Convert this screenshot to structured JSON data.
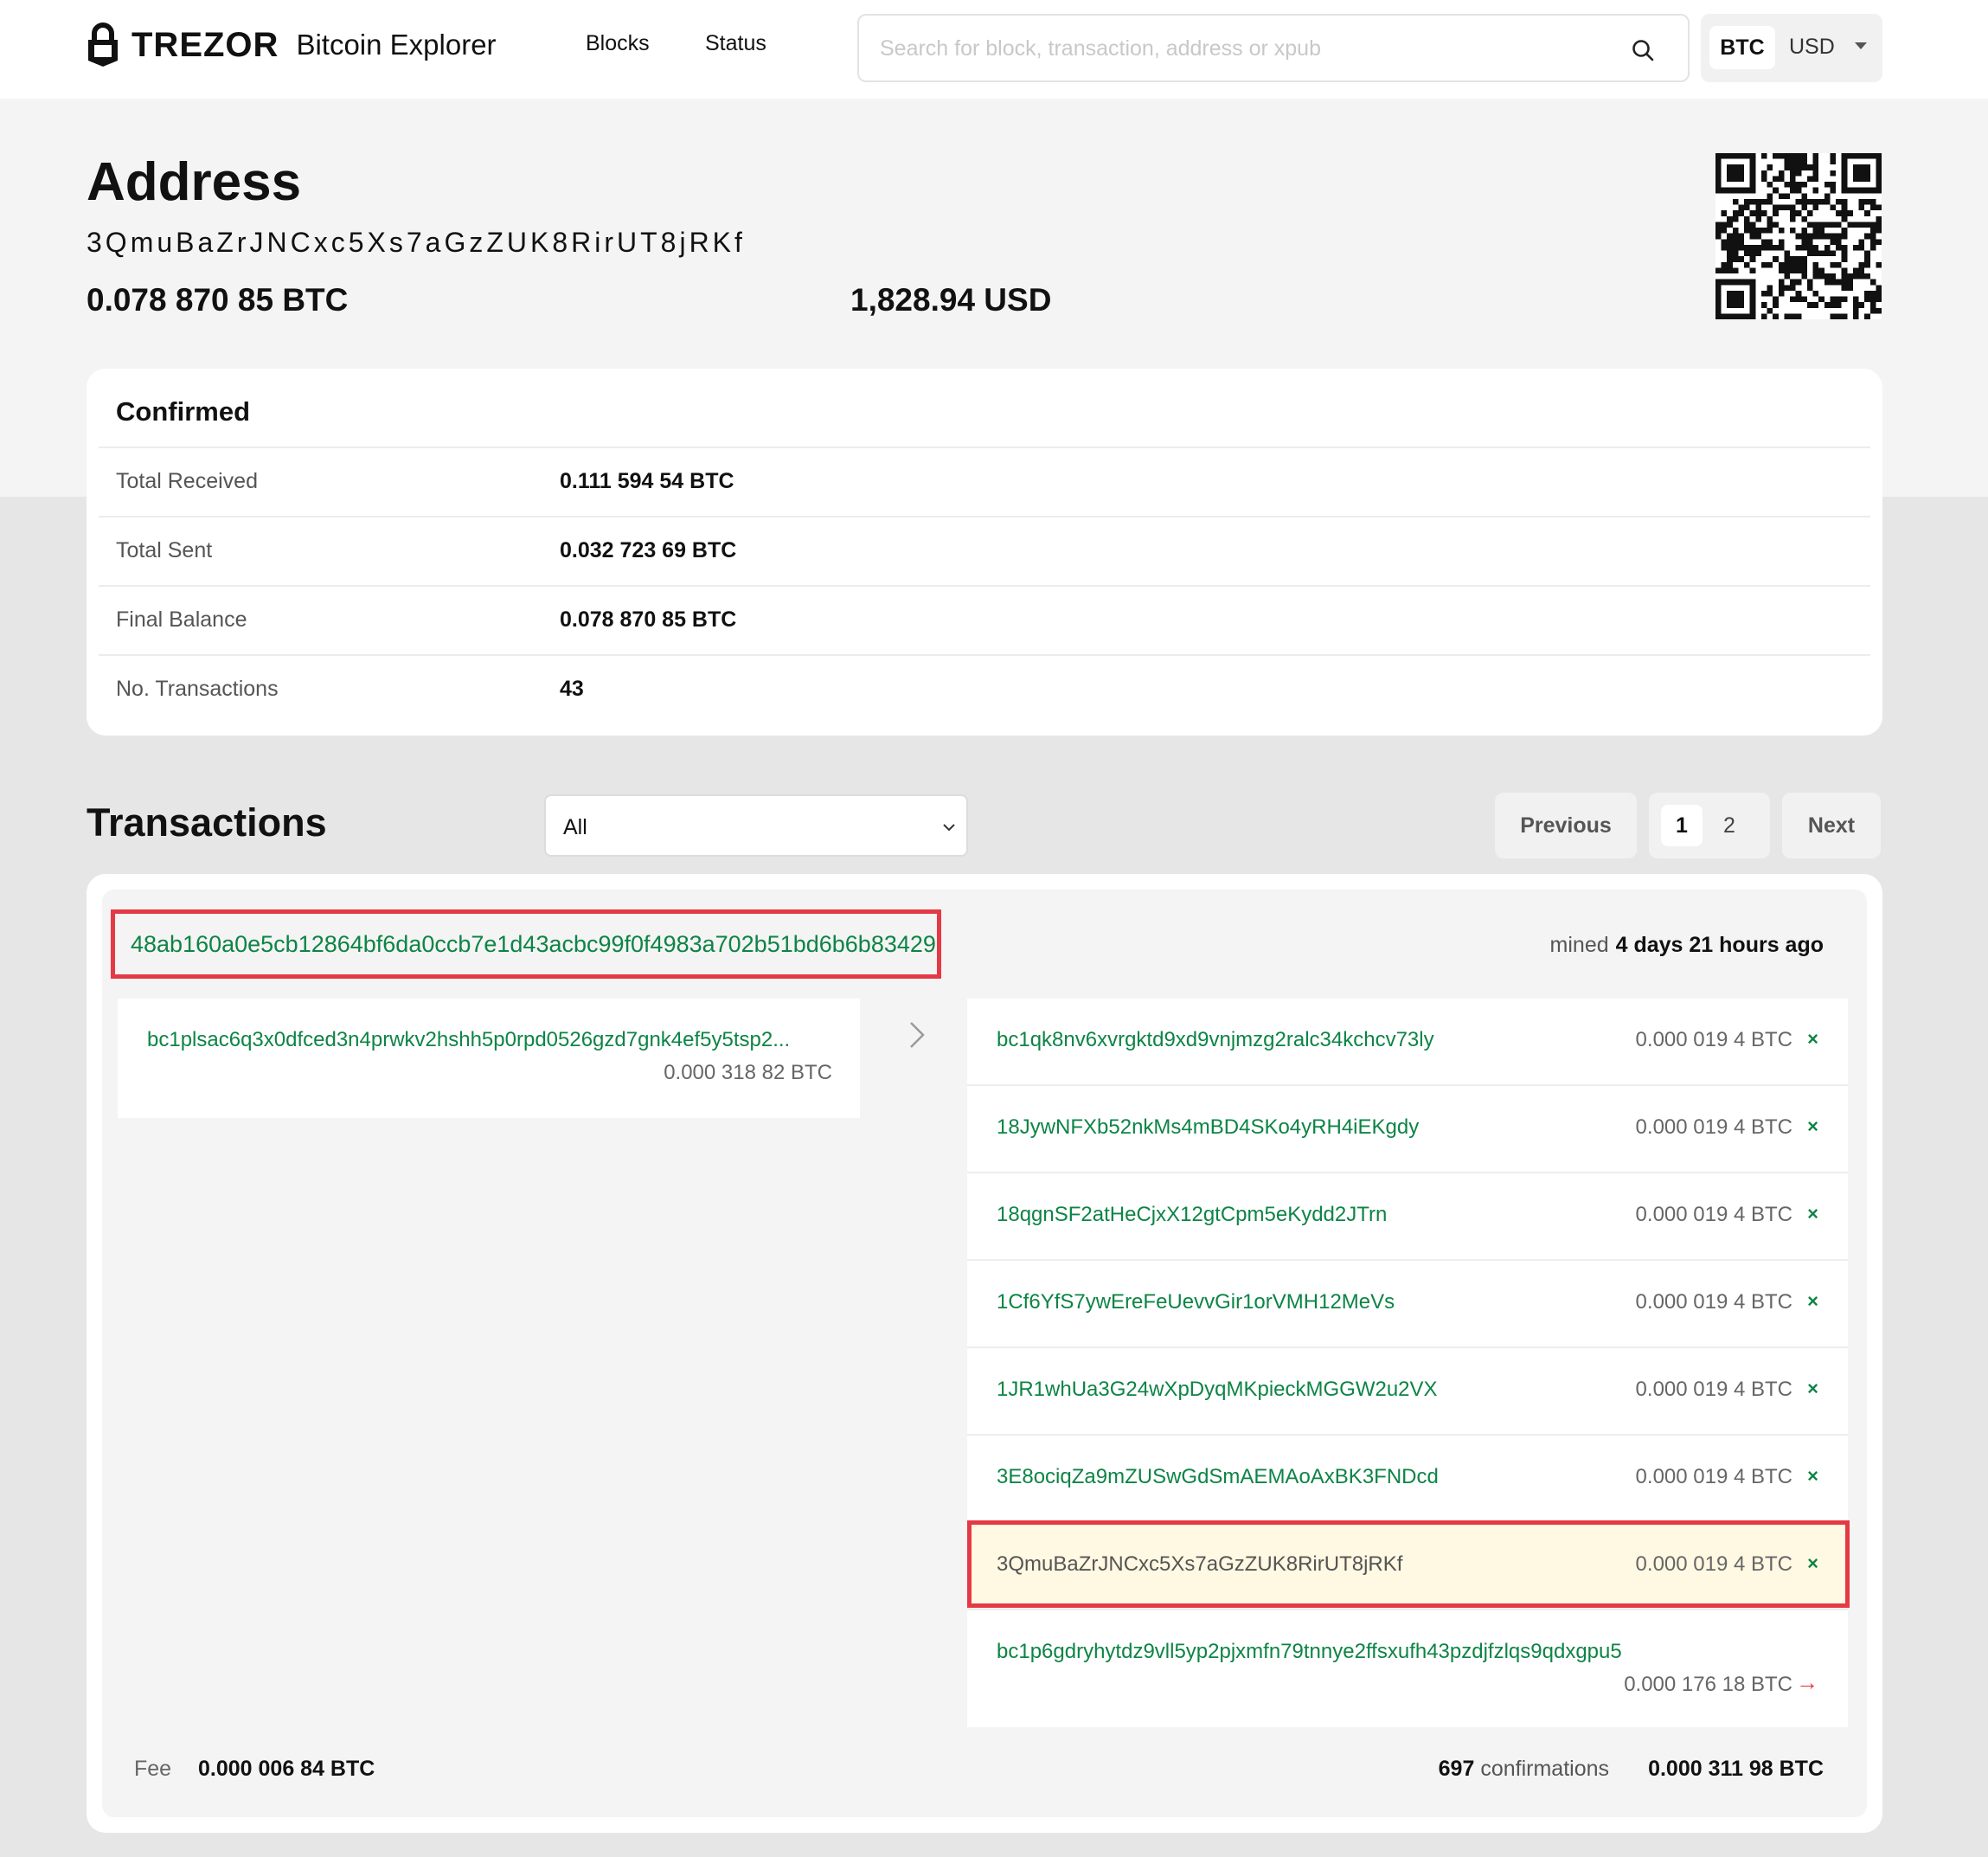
{
  "header": {
    "brand": "TREZOR",
    "app_name": "Bitcoin Explorer",
    "nav": [
      "Blocks",
      "Status"
    ],
    "search_placeholder": "Search for block, transaction, address or xpub",
    "currency": {
      "primary": "BTC",
      "secondary": "USD"
    }
  },
  "address": {
    "title": "Address",
    "hash": "3QmuBaZrJNCxc5Xs7aGzZUK8RirUT8jRKf",
    "balance_btc": "0.078 870 85 BTC",
    "balance_usd": "1,828.94 USD"
  },
  "confirmed": {
    "title": "Confirmed",
    "rows": [
      {
        "label": "Total Received",
        "value": "0.111 594 54 BTC"
      },
      {
        "label": "Total Sent",
        "value": "0.032 723 69 BTC"
      },
      {
        "label": "Final Balance",
        "value": "0.078 870 85 BTC"
      },
      {
        "label": "No. Transactions",
        "value": "43"
      }
    ]
  },
  "transactions": {
    "title": "Transactions",
    "filter": "All",
    "pagination": {
      "previous": "Previous",
      "pages": [
        "1",
        "2"
      ],
      "next": "Next"
    },
    "tx": {
      "hash": "48ab160a0e5cb12864bf6da0ccb7e1d43acbc99f0f4983a702b51bd6b6b83429",
      "mined_label": "mined",
      "mined_ago": "4 days 21 hours ago",
      "inputs": [
        {
          "address": "bc1plsac6q3x0dfced3n4prwkv2hshh5p0rpd0526gzd7gnk4ef5y5tsp2...",
          "amount": "0.000 318 82 BTC"
        }
      ],
      "outputs": [
        {
          "address": "bc1qk8nv6xvrgktd9xd9vnjmzg2ralc34kchcv73ly",
          "amount": "0.000 019 4 BTC",
          "mark": "×"
        },
        {
          "address": "18JywNFXb52nkMs4mBD4SKo4yRH4iEKgdy",
          "amount": "0.000 019 4 BTC",
          "mark": "×"
        },
        {
          "address": "18qgnSF2atHeCjxX12gtCpm5eKydd2JTrn",
          "amount": "0.000 019 4 BTC",
          "mark": "×"
        },
        {
          "address": "1Cf6YfS7ywEreFeUevvGir1orVMH12MeVs",
          "amount": "0.000 019 4 BTC",
          "mark": "×"
        },
        {
          "address": "1JR1whUa3G24wXpDyqMKpieckMGGW2u2VX",
          "amount": "0.000 019 4 BTC",
          "mark": "×"
        },
        {
          "address": "3E8ociqZa9mZUSwGdSmAEMAoAxBK3FNDcd",
          "amount": "0.000 019 4 BTC",
          "mark": "×"
        },
        {
          "address": "3QmuBaZrJNCxc5Xs7aGzZUK8RirUT8jRKf",
          "amount": "0.000 019 4 BTC",
          "mark": "×"
        },
        {
          "address": "bc1p6gdryhytdz9vll5yp2pjxmfn79tnnye2ffsxufh43pzdjfzlqs9qdxgpu5",
          "amount": "0.000 176 18 BTC",
          "mark": "→"
        }
      ],
      "fee_label": "Fee",
      "fee": "0.000 006 84 BTC",
      "confirmations": "697",
      "confirmations_label": "confirmations",
      "total": "0.000 311 98 BTC"
    }
  },
  "colors": {
    "link_green": "#0d8445",
    "highlight_red": "#e53945",
    "highlight_bg": "#fff8e2"
  }
}
